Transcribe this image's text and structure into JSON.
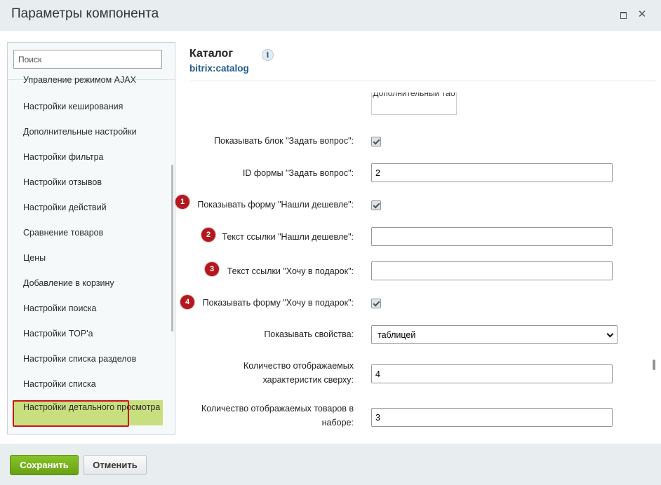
{
  "window": {
    "title": "Параметры компонента",
    "maximize_icon": "maximize-icon",
    "close_glyph": "✕"
  },
  "sidebar": {
    "search_placeholder": "Поиск",
    "items": [
      {
        "label": "Управление режимом AJAX"
      },
      {
        "label": "Настройки кеширования"
      },
      {
        "label": "Дополнительные настройки"
      },
      {
        "label": "Настройки фильтра"
      },
      {
        "label": "Настройки отзывов"
      },
      {
        "label": "Настройки действий"
      },
      {
        "label": "Сравнение товаров"
      },
      {
        "label": "Цены"
      },
      {
        "label": "Добавление в корзину"
      },
      {
        "label": "Настройки поиска"
      },
      {
        "label": "Настройки TOP'а"
      },
      {
        "label": "Настройки списка разделов"
      },
      {
        "label": "Настройки списка"
      },
      {
        "label": "Настройки детального просмотра"
      }
    ],
    "active_index": 13
  },
  "component": {
    "title": "Каталог",
    "code": "bitrix:catalog",
    "info_glyph": "i"
  },
  "partial_tab": "Дополнительный таб",
  "fields": {
    "show_ask_block": {
      "label": "Показывать блок \"Задать вопрос\":",
      "checked": true
    },
    "ask_form_id": {
      "label": "ID формы \"Задать вопрос\":",
      "value": "2"
    },
    "show_cheaper_form": {
      "label": "Показывать форму \"Нашли дешевле\":",
      "checked": true,
      "badge": "1"
    },
    "cheaper_link_text": {
      "label": "Текст ссылки \"Нашли дешевле\":",
      "value": "",
      "badge": "2"
    },
    "gift_link_text": {
      "label": "Текст ссылки \"Хочу в подарок\":",
      "value": "",
      "badge": "3"
    },
    "show_gift_form": {
      "label": "Показывать форму \"Хочу в подарок\":",
      "checked": true,
      "badge": "4"
    },
    "show_props": {
      "label": "Показывать свойства:",
      "value": "таблицей"
    },
    "props_count_top": {
      "label_line1": "Количество отображаемых",
      "label_line2": "характеристик сверху:",
      "value": "4"
    },
    "set_items_count": {
      "label_line1": "Количество отображаемых товаров в",
      "label_line2": "наборе:",
      "value": "3"
    }
  },
  "footer": {
    "save_label": "Сохранить",
    "cancel_label": "Отменить"
  },
  "colors": {
    "save_button": "#6aa014",
    "active_item": "#c8df7f",
    "highlight_border": "#c5161d",
    "badge": "#b3181e",
    "link_blue": "#1f5b8c"
  }
}
